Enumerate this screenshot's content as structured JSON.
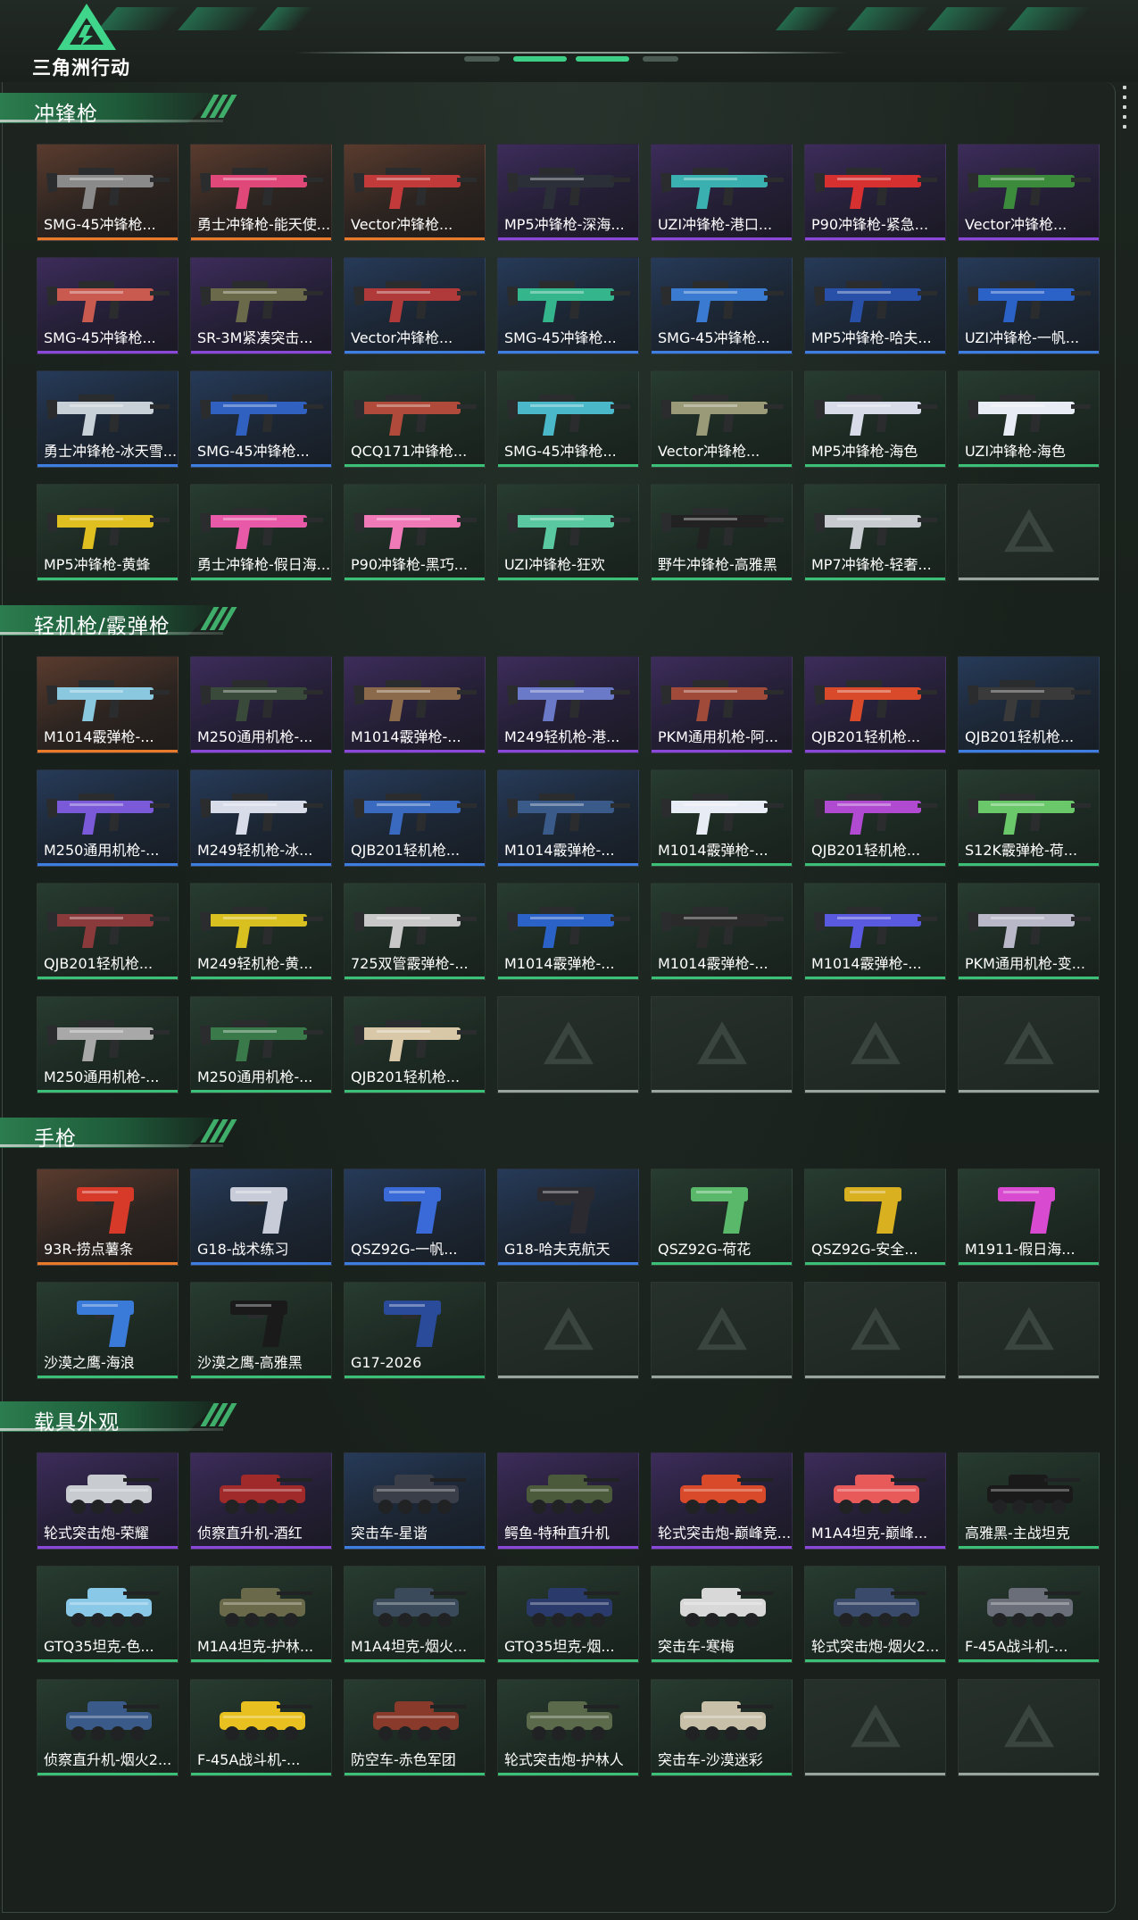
{
  "header": {
    "logo_text": "三角洲行动"
  },
  "sections": [
    {
      "title": "冲锋枪",
      "kind": "gun",
      "items": [
        {
          "label": "SMG-45冲锋枪...",
          "rarity": "orange",
          "color": "#8a8a8a"
        },
        {
          "label": "勇士冲锋枪-能天使...",
          "rarity": "orange",
          "color": "#e0487a"
        },
        {
          "label": "Vector冲锋枪...",
          "rarity": "orange",
          "color": "#c23a3a"
        },
        {
          "label": "MP5冲锋枪-深海...",
          "rarity": "purple",
          "color": "#2a2f38"
        },
        {
          "label": "UZI冲锋枪-港口...",
          "rarity": "purple",
          "color": "#3ab0b0"
        },
        {
          "label": "P90冲锋枪-紧急...",
          "rarity": "purple",
          "color": "#d63030"
        },
        {
          "label": "Vector冲锋枪...",
          "rarity": "purple",
          "color": "#3c8a3c"
        },
        {
          "label": "SMG-45冲锋枪...",
          "rarity": "purple",
          "color": "#c85a50"
        },
        {
          "label": "SR-3M紧凑突击...",
          "rarity": "purple",
          "color": "#6a6a4a"
        },
        {
          "label": "Vector冲锋枪...",
          "rarity": "blue",
          "color": "#b03a3a"
        },
        {
          "label": "SMG-45冲锋枪...",
          "rarity": "blue",
          "color": "#35b58c"
        },
        {
          "label": "SMG-45冲锋枪...",
          "rarity": "blue",
          "color": "#3a7ad0"
        },
        {
          "label": "MP5冲锋枪-哈夫...",
          "rarity": "blue",
          "color": "#2850a8"
        },
        {
          "label": "UZI冲锋枪-一帆...",
          "rarity": "blue",
          "color": "#2a62c8"
        },
        {
          "label": "勇士冲锋枪-冰天雪...",
          "rarity": "blue",
          "color": "#c8d0d8"
        },
        {
          "label": "SMG-45冲锋枪...",
          "rarity": "blue",
          "color": "#3060c0"
        },
        {
          "label": "QCQ171冲锋枪...",
          "rarity": "green",
          "color": "#b04a3a"
        },
        {
          "label": "SMG-45冲锋枪...",
          "rarity": "green",
          "color": "#4ab8c8"
        },
        {
          "label": "Vector冲锋枪...",
          "rarity": "green",
          "color": "#9a9a78"
        },
        {
          "label": "MP5冲锋枪-海色",
          "rarity": "green",
          "color": "#d8dce8"
        },
        {
          "label": "UZI冲锋枪-海色",
          "rarity": "green",
          "color": "#e8ecf4"
        },
        {
          "label": "MP5冲锋枪-黄蜂",
          "rarity": "green",
          "color": "#e0c020"
        },
        {
          "label": "勇士冲锋枪-假日海...",
          "rarity": "green",
          "color": "#e85aa8"
        },
        {
          "label": "P90冲锋枪-黑巧...",
          "rarity": "green",
          "color": "#f07ab8"
        },
        {
          "label": "UZI冲锋枪-狂欢",
          "rarity": "green",
          "color": "#5ac8a0"
        },
        {
          "label": "野牛冲锋枪-高雅黑",
          "rarity": "green",
          "color": "#222222"
        },
        {
          "label": "MP7冲锋枪-轻奢...",
          "rarity": "green",
          "color": "#c8ccd0"
        },
        {
          "label": "",
          "rarity": "empty",
          "color": ""
        }
      ]
    },
    {
      "title": "轻机枪/霰弹枪",
      "kind": "gun",
      "items": [
        {
          "label": "M1014霰弹枪-...",
          "rarity": "orange",
          "color": "#8ac8e0"
        },
        {
          "label": "M250通用机枪-...",
          "rarity": "purple",
          "color": "#3a4a3a"
        },
        {
          "label": "M1014霰弹枪-...",
          "rarity": "purple",
          "color": "#8a6a4a"
        },
        {
          "label": "M249轻机枪-港...",
          "rarity": "purple",
          "color": "#6a7ac8"
        },
        {
          "label": "PKM通用机枪-阿...",
          "rarity": "purple",
          "color": "#a04a3a"
        },
        {
          "label": "QJB201轻机枪...",
          "rarity": "purple",
          "color": "#d84a2a"
        },
        {
          "label": "QJB201轻机枪...",
          "rarity": "blue",
          "color": "#3a3a3a"
        },
        {
          "label": "M250通用机枪-...",
          "rarity": "blue",
          "color": "#7a5ad8"
        },
        {
          "label": "M249轻机枪-冰...",
          "rarity": "blue",
          "color": "#d8dce8"
        },
        {
          "label": "QJB201轻机枪...",
          "rarity": "blue",
          "color": "#3a6ac0"
        },
        {
          "label": "M1014霰弹枪-...",
          "rarity": "blue",
          "color": "#3a5a8a"
        },
        {
          "label": "M1014霰弹枪-...",
          "rarity": "green",
          "color": "#e8ecf4"
        },
        {
          "label": "QJB201轻机枪...",
          "rarity": "green",
          "color": "#b04ad0"
        },
        {
          "label": "S12K霰弹枪-荷...",
          "rarity": "green",
          "color": "#6ac86a"
        },
        {
          "label": "QJB201轻机枪...",
          "rarity": "green",
          "color": "#8a3a3a"
        },
        {
          "label": "M249轻机枪-黄...",
          "rarity": "green",
          "color": "#d8c020"
        },
        {
          "label": "725双管霰弹枪-...",
          "rarity": "green",
          "color": "#c8c8c8"
        },
        {
          "label": "M1014霰弹枪-...",
          "rarity": "green",
          "color": "#2a62c8"
        },
        {
          "label": "M1014霰弹枪-...",
          "rarity": "green",
          "color": "#2a2a2a"
        },
        {
          "label": "M1014霰弹枪-...",
          "rarity": "green",
          "color": "#5a5ae0"
        },
        {
          "label": "PKM通用机枪-变...",
          "rarity": "green",
          "color": "#b8b8c8"
        },
        {
          "label": "M250通用机枪-...",
          "rarity": "green",
          "color": "#a8a8a8"
        },
        {
          "label": "M250通用机枪-...",
          "rarity": "green",
          "color": "#3a7a4a"
        },
        {
          "label": "QJB201轻机枪...",
          "rarity": "green",
          "color": "#d8c8a8"
        },
        {
          "label": "",
          "rarity": "empty",
          "color": ""
        },
        {
          "label": "",
          "rarity": "empty",
          "color": ""
        },
        {
          "label": "",
          "rarity": "empty",
          "color": ""
        },
        {
          "label": "",
          "rarity": "empty",
          "color": ""
        }
      ]
    },
    {
      "title": "手枪",
      "kind": "pistol",
      "items": [
        {
          "label": "93R-捞点薯条",
          "rarity": "orange",
          "color": "#d83a2a"
        },
        {
          "label": "G18-战术练习",
          "rarity": "blue",
          "color": "#c8ccd8"
        },
        {
          "label": "QSZ92G-一帆...",
          "rarity": "blue",
          "color": "#3a6ad8"
        },
        {
          "label": "G18-哈夫克航天",
          "rarity": "blue",
          "color": "#2a2a30"
        },
        {
          "label": "QSZ92G-荷花",
          "rarity": "green",
          "color": "#5ab86a"
        },
        {
          "label": "QSZ92G-安全...",
          "rarity": "green",
          "color": "#d8b020"
        },
        {
          "label": "M1911-假日海...",
          "rarity": "green",
          "color": "#d84ad0"
        },
        {
          "label": "沙漠之鹰-海浪",
          "rarity": "green",
          "color": "#3a7ad8"
        },
        {
          "label": "沙漠之鹰-高雅黑",
          "rarity": "green",
          "color": "#1a1a1a"
        },
        {
          "label": "G17-2026",
          "rarity": "green",
          "color": "#2a4a9a"
        },
        {
          "label": "",
          "rarity": "empty",
          "color": ""
        },
        {
          "label": "",
          "rarity": "empty",
          "color": ""
        },
        {
          "label": "",
          "rarity": "empty",
          "color": ""
        },
        {
          "label": "",
          "rarity": "empty",
          "color": ""
        }
      ]
    },
    {
      "title": "载具外观",
      "kind": "vehicle",
      "items": [
        {
          "label": "轮式突击炮-荣耀",
          "rarity": "purple",
          "color": "#c8ccd0"
        },
        {
          "label": "侦察直升机-酒红",
          "rarity": "purple",
          "color": "#a02a2a"
        },
        {
          "label": "突击车-星谐",
          "rarity": "blue",
          "color": "#3a3e48"
        },
        {
          "label": "鳄鱼-特种直升机",
          "rarity": "purple",
          "color": "#4a5a3a"
        },
        {
          "label": "轮式突击炮-巅峰竞...",
          "rarity": "purple",
          "color": "#d84a2a"
        },
        {
          "label": "M1A4坦克-巅峰...",
          "rarity": "purple",
          "color": "#e85a5a"
        },
        {
          "label": "高雅黑-主战坦克",
          "rarity": "green",
          "color": "#1a1a1a"
        },
        {
          "label": "GTQ35坦克-色...",
          "rarity": "green",
          "color": "#8ac8e8"
        },
        {
          "label": "M1A4坦克-护林...",
          "rarity": "green",
          "color": "#6a6a4a"
        },
        {
          "label": "M1A4坦克-烟火...",
          "rarity": "green",
          "color": "#3a4a5a"
        },
        {
          "label": "GTQ35坦克-烟...",
          "rarity": "green",
          "color": "#2a3a6a"
        },
        {
          "label": "突击车-寒梅",
          "rarity": "green",
          "color": "#d8d8d8"
        },
        {
          "label": "轮式突击炮-烟火2...",
          "rarity": "green",
          "color": "#3a4a6a"
        },
        {
          "label": "F-45A战斗机-...",
          "rarity": "green",
          "color": "#6a6e78"
        },
        {
          "label": "侦察直升机-烟火2...",
          "rarity": "green",
          "color": "#3a5a8a"
        },
        {
          "label": "F-45A战斗机-...",
          "rarity": "green",
          "color": "#e8c020"
        },
        {
          "label": "防空车-赤色军团",
          "rarity": "green",
          "color": "#8a3a2a"
        },
        {
          "label": "轮式突击炮-护林人",
          "rarity": "green",
          "color": "#5a6a4a"
        },
        {
          "label": "突击车-沙漠迷彩",
          "rarity": "green",
          "color": "#c8c0a8"
        },
        {
          "label": "",
          "rarity": "empty",
          "color": ""
        },
        {
          "label": "",
          "rarity": "empty",
          "color": ""
        }
      ]
    }
  ]
}
